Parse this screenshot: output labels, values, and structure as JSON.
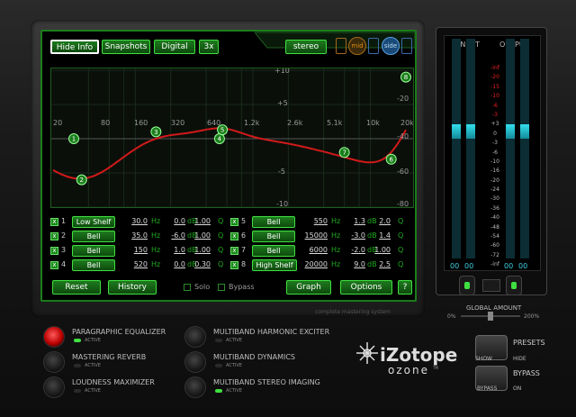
{
  "topbar": {
    "hide_info": "Hide Info",
    "snapshots": "Snapshots",
    "digital": "Digital",
    "oversample": "3x",
    "stereo": "stereo",
    "mid": "mid",
    "side": "side"
  },
  "graph": {
    "freq_labels": [
      "20",
      "80",
      "160",
      "320",
      "640",
      "1.2k",
      "2.6k",
      "5.1k",
      "10k",
      "20k"
    ],
    "db_labels": [
      "+10",
      "+5",
      "-5",
      "-10"
    ],
    "right_db_labels": [
      "-20",
      "-40",
      "-60",
      "-80"
    ],
    "nodes": [
      "1",
      "2",
      "3",
      "4",
      "5",
      "6",
      "7",
      "8"
    ]
  },
  "bands": [
    {
      "num": "1",
      "type": "Low Shelf",
      "freq": "30.0",
      "gain": "0.0",
      "q": "1.00"
    },
    {
      "num": "2",
      "type": "Bell",
      "freq": "35.0",
      "gain": "-6.0",
      "q": "1.00"
    },
    {
      "num": "3",
      "type": "Bell",
      "freq": "150",
      "gain": "1.0",
      "q": "1.00"
    },
    {
      "num": "4",
      "type": "Bell",
      "freq": "520",
      "gain": "0.0",
      "q": "0.30"
    },
    {
      "num": "5",
      "type": "Bell",
      "freq": "550",
      "gain": "1.3",
      "q": "2.0"
    },
    {
      "num": "6",
      "type": "Bell",
      "freq": "15000",
      "gain": "-3.0",
      "q": "1.4"
    },
    {
      "num": "7",
      "type": "Bell",
      "freq": "6000",
      "gain": "-2.0",
      "q": "1.00"
    },
    {
      "num": "8",
      "type": "High Shelf",
      "freq": "20000",
      "gain": "9.0",
      "q": "2.5"
    }
  ],
  "units": {
    "hz": "Hz",
    "db": "dB",
    "q": "Q",
    "check": "x"
  },
  "bottom": {
    "reset": "Reset",
    "history": "History",
    "solo": "Solo",
    "bypass": "Bypass",
    "graph": "Graph",
    "options": "Options",
    "help": "?"
  },
  "screen_caption": "complete mastering system",
  "meters": {
    "input": "INPUT",
    "output": "OUTPUT",
    "scale": [
      "-inf",
      "-20",
      "-15",
      "-10",
      "-6",
      "-3",
      "+3",
      "0",
      "-3",
      "-6",
      "-10",
      "-16",
      "-20",
      "-24",
      "-30",
      "-36",
      "-40",
      "-48",
      "-54",
      "-60",
      "-72",
      "-inf"
    ],
    "values": [
      "00",
      "00",
      "00",
      "00"
    ]
  },
  "global_amount": {
    "label": "GLOBAL AMOUNT",
    "min": "0%",
    "max": "200%"
  },
  "modules": [
    {
      "name": "PARAGRAPHIC EQUALIZER",
      "active": true
    },
    {
      "name": "MASTERING REVERB",
      "active": false
    },
    {
      "name": "LOUDNESS MAXIMIZER",
      "active": false
    },
    {
      "name": "MULTIBAND HARMONIC EXCITER",
      "active": false
    },
    {
      "name": "MULTIBAND DYNAMICS",
      "active": false
    },
    {
      "name": "MULTIBAND STEREO IMAGING",
      "active": true
    }
  ],
  "active_label": "ACTIVE",
  "brand": {
    "name": "iZotope",
    "product": "ozone",
    "tm": "TM"
  },
  "presets": {
    "label": "PRESETS",
    "show": "SHOW",
    "hide": "HIDE"
  },
  "bypass": {
    "label": "BYPASS",
    "bypass": "BYPASS",
    "on": "ON"
  },
  "colors": {
    "accent": "#3fe03f",
    "curve": "#d21a1a",
    "meter": "#33e0ee"
  }
}
